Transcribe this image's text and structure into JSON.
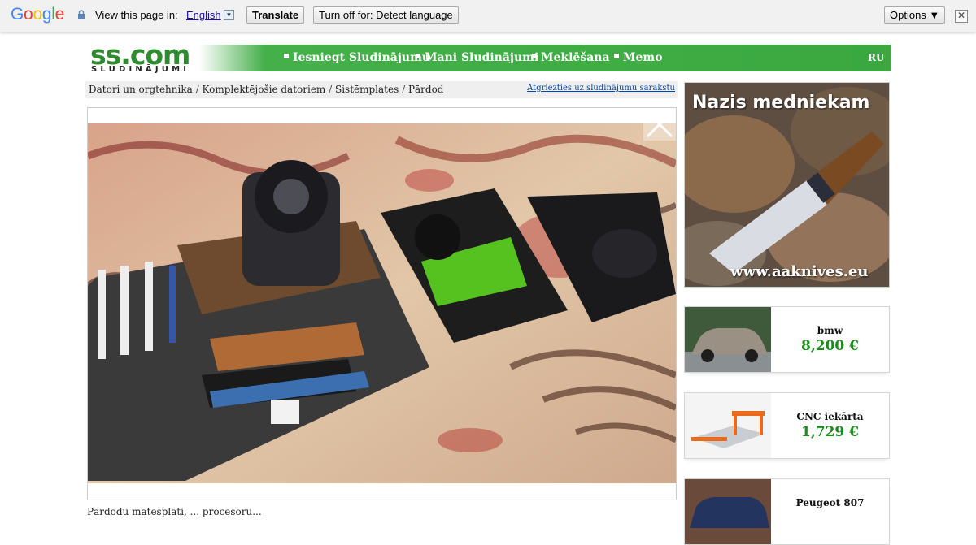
{
  "translate_bar": {
    "logo_letters": [
      "G",
      "o",
      "o",
      "g",
      "l",
      "e"
    ],
    "logo_colors": [
      "#4285f4",
      "#ea4335",
      "#fbbc05",
      "#4285f4",
      "#34a853",
      "#ea4335"
    ],
    "prompt": "View this page in:",
    "language": "English",
    "translate_button": "Translate",
    "turn_off_button": "Turn off for: Detect language",
    "options_button": "Options ▼",
    "close_glyph": "✕"
  },
  "header": {
    "logo_text": "ss.com",
    "logo_subtitle": "SLUDINĀJUMI",
    "nav": [
      {
        "label": "Iesniegt Sludinājumu"
      },
      {
        "label": "Mani Sludinājumi"
      },
      {
        "label": "Meklēšana"
      },
      {
        "label": "Memo"
      }
    ],
    "language_switch": "RU",
    "accent_color": "#3aa83f"
  },
  "breadcrumb": {
    "items": [
      "Datori un orgtehnika",
      "Komplektējošie datoriem",
      "Sistēmplates",
      "Pārdod"
    ],
    "separator": " / ",
    "back_link": "Atgriezties uz sludinājumu sarakstu"
  },
  "listing": {
    "description_fragment": "Pārdodu mātesplati, ... procesoru..."
  },
  "sidebar": {
    "banner": {
      "title": "Nazis medniekam",
      "url": "www.aaknives.eu"
    },
    "cards": [
      {
        "title": "bmw",
        "price": "8,200 €",
        "icon": "car-photo"
      },
      {
        "title": "CNC iekārta",
        "price": "1,729 €",
        "icon": "cnc-machine-photo"
      },
      {
        "title": "Peugeot 807",
        "price": "",
        "icon": "car-photo"
      }
    ]
  }
}
